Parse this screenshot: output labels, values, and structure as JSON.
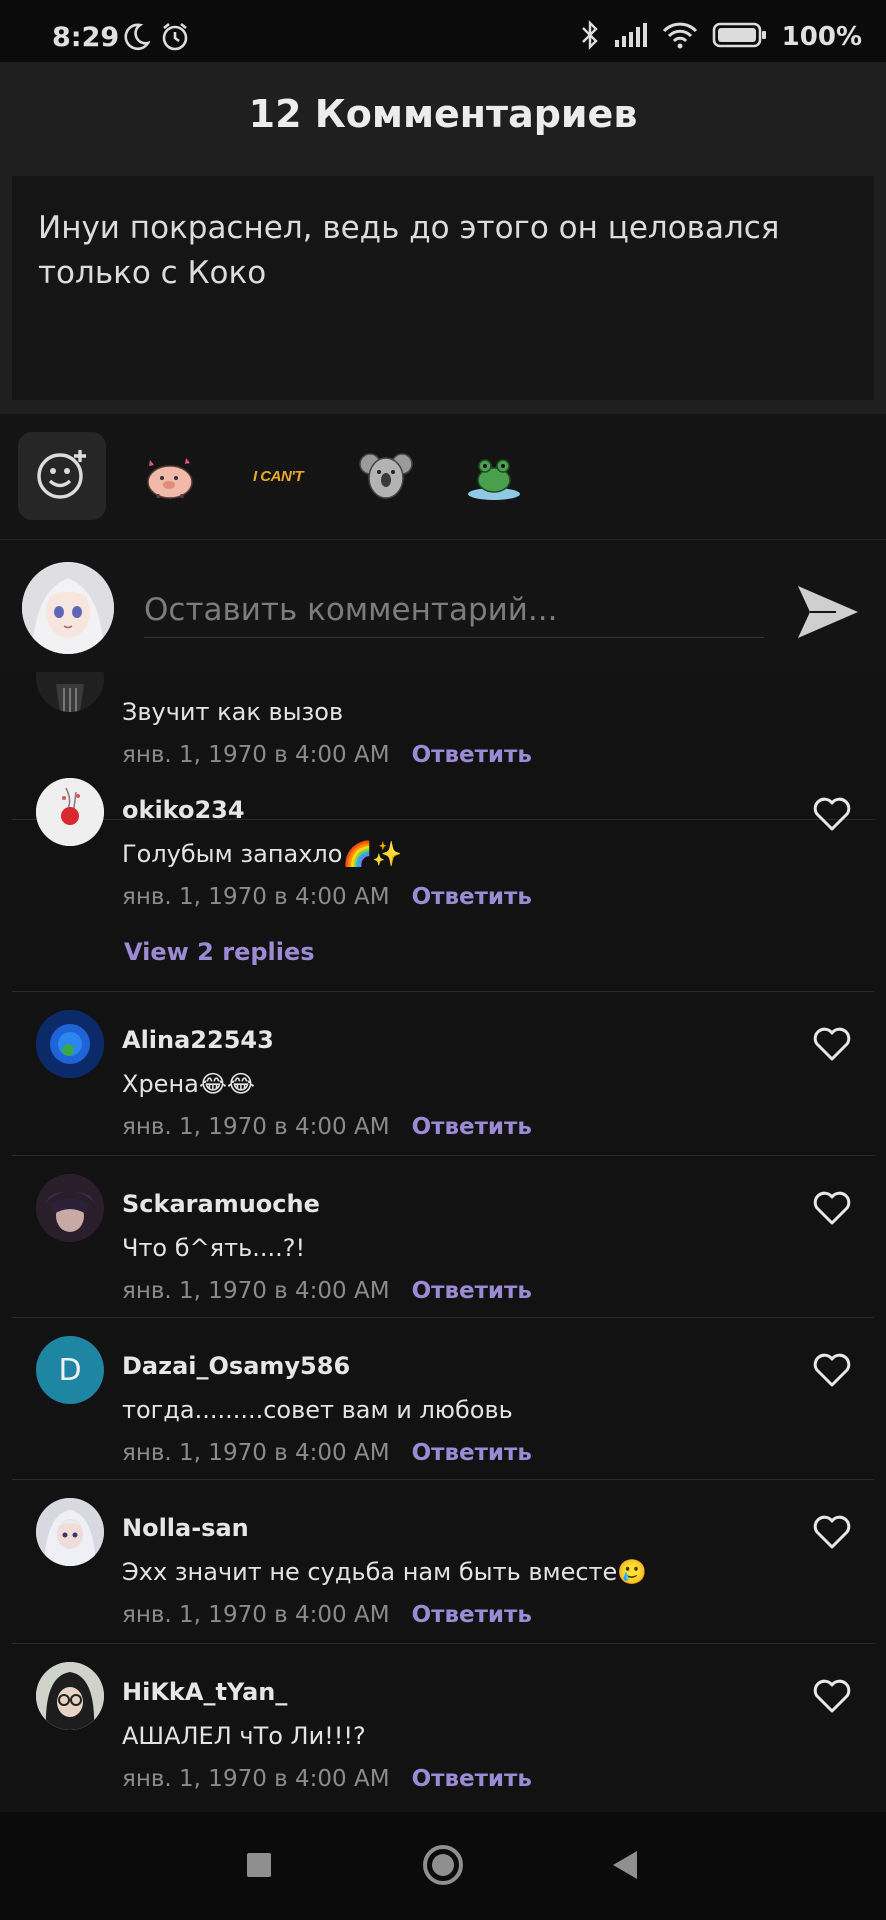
{
  "status_bar": {
    "time": "8:29",
    "battery": "100%"
  },
  "header": {
    "title": "12 Комментариев"
  },
  "quote": {
    "text": "Инуи покраснел, ведь до этого он целовался только с Коко"
  },
  "stickers": [
    {
      "name": "emoji-add-icon"
    },
    {
      "name": "pig-sticker"
    },
    {
      "name": "i-cant-sticker",
      "text": "I CAN'T"
    },
    {
      "name": "koala-sticker"
    },
    {
      "name": "frog-sticker"
    }
  ],
  "input": {
    "placeholder": "Оставить комментарий..."
  },
  "reply_label": "Ответить",
  "comments": [
    {
      "username": "",
      "text": "Звучит как вызов",
      "date": "янв. 1, 1970 в 4:00 AM"
    },
    {
      "username": "okiko234",
      "text": "Голубым запахло🌈✨",
      "date": "янв. 1, 1970 в 4:00 AM",
      "view_replies": "View 2 replies"
    },
    {
      "username": "Alina22543",
      "text": "Хрена😂😂",
      "date": "янв. 1, 1970 в 4:00 AM"
    },
    {
      "username": "Sckaramuoche",
      "text": "Что б^ять....?!",
      "date": "янв. 1, 1970 в 4:00 AM"
    },
    {
      "username": "Dazai_Osamy586",
      "text": "тогда.........совет вам и любовь",
      "date": "янв. 1, 1970 в 4:00 AM",
      "avatar_letter": "D",
      "avatar_color": "#1e86a3"
    },
    {
      "username": "Nolla-san",
      "text": "Эхх значит не судьба нам быть вместе🥲",
      "date": "янв. 1, 1970 в 4:00 AM"
    },
    {
      "username": "HiKkA_tYan_",
      "text": "АШАЛЕЛ чТо Ли!!!?",
      "date": "янв. 1, 1970 в 4:00 AM"
    }
  ],
  "colors": {
    "accent": "#9a8bd4",
    "background": "#121212",
    "panel": "#1f1f20"
  }
}
